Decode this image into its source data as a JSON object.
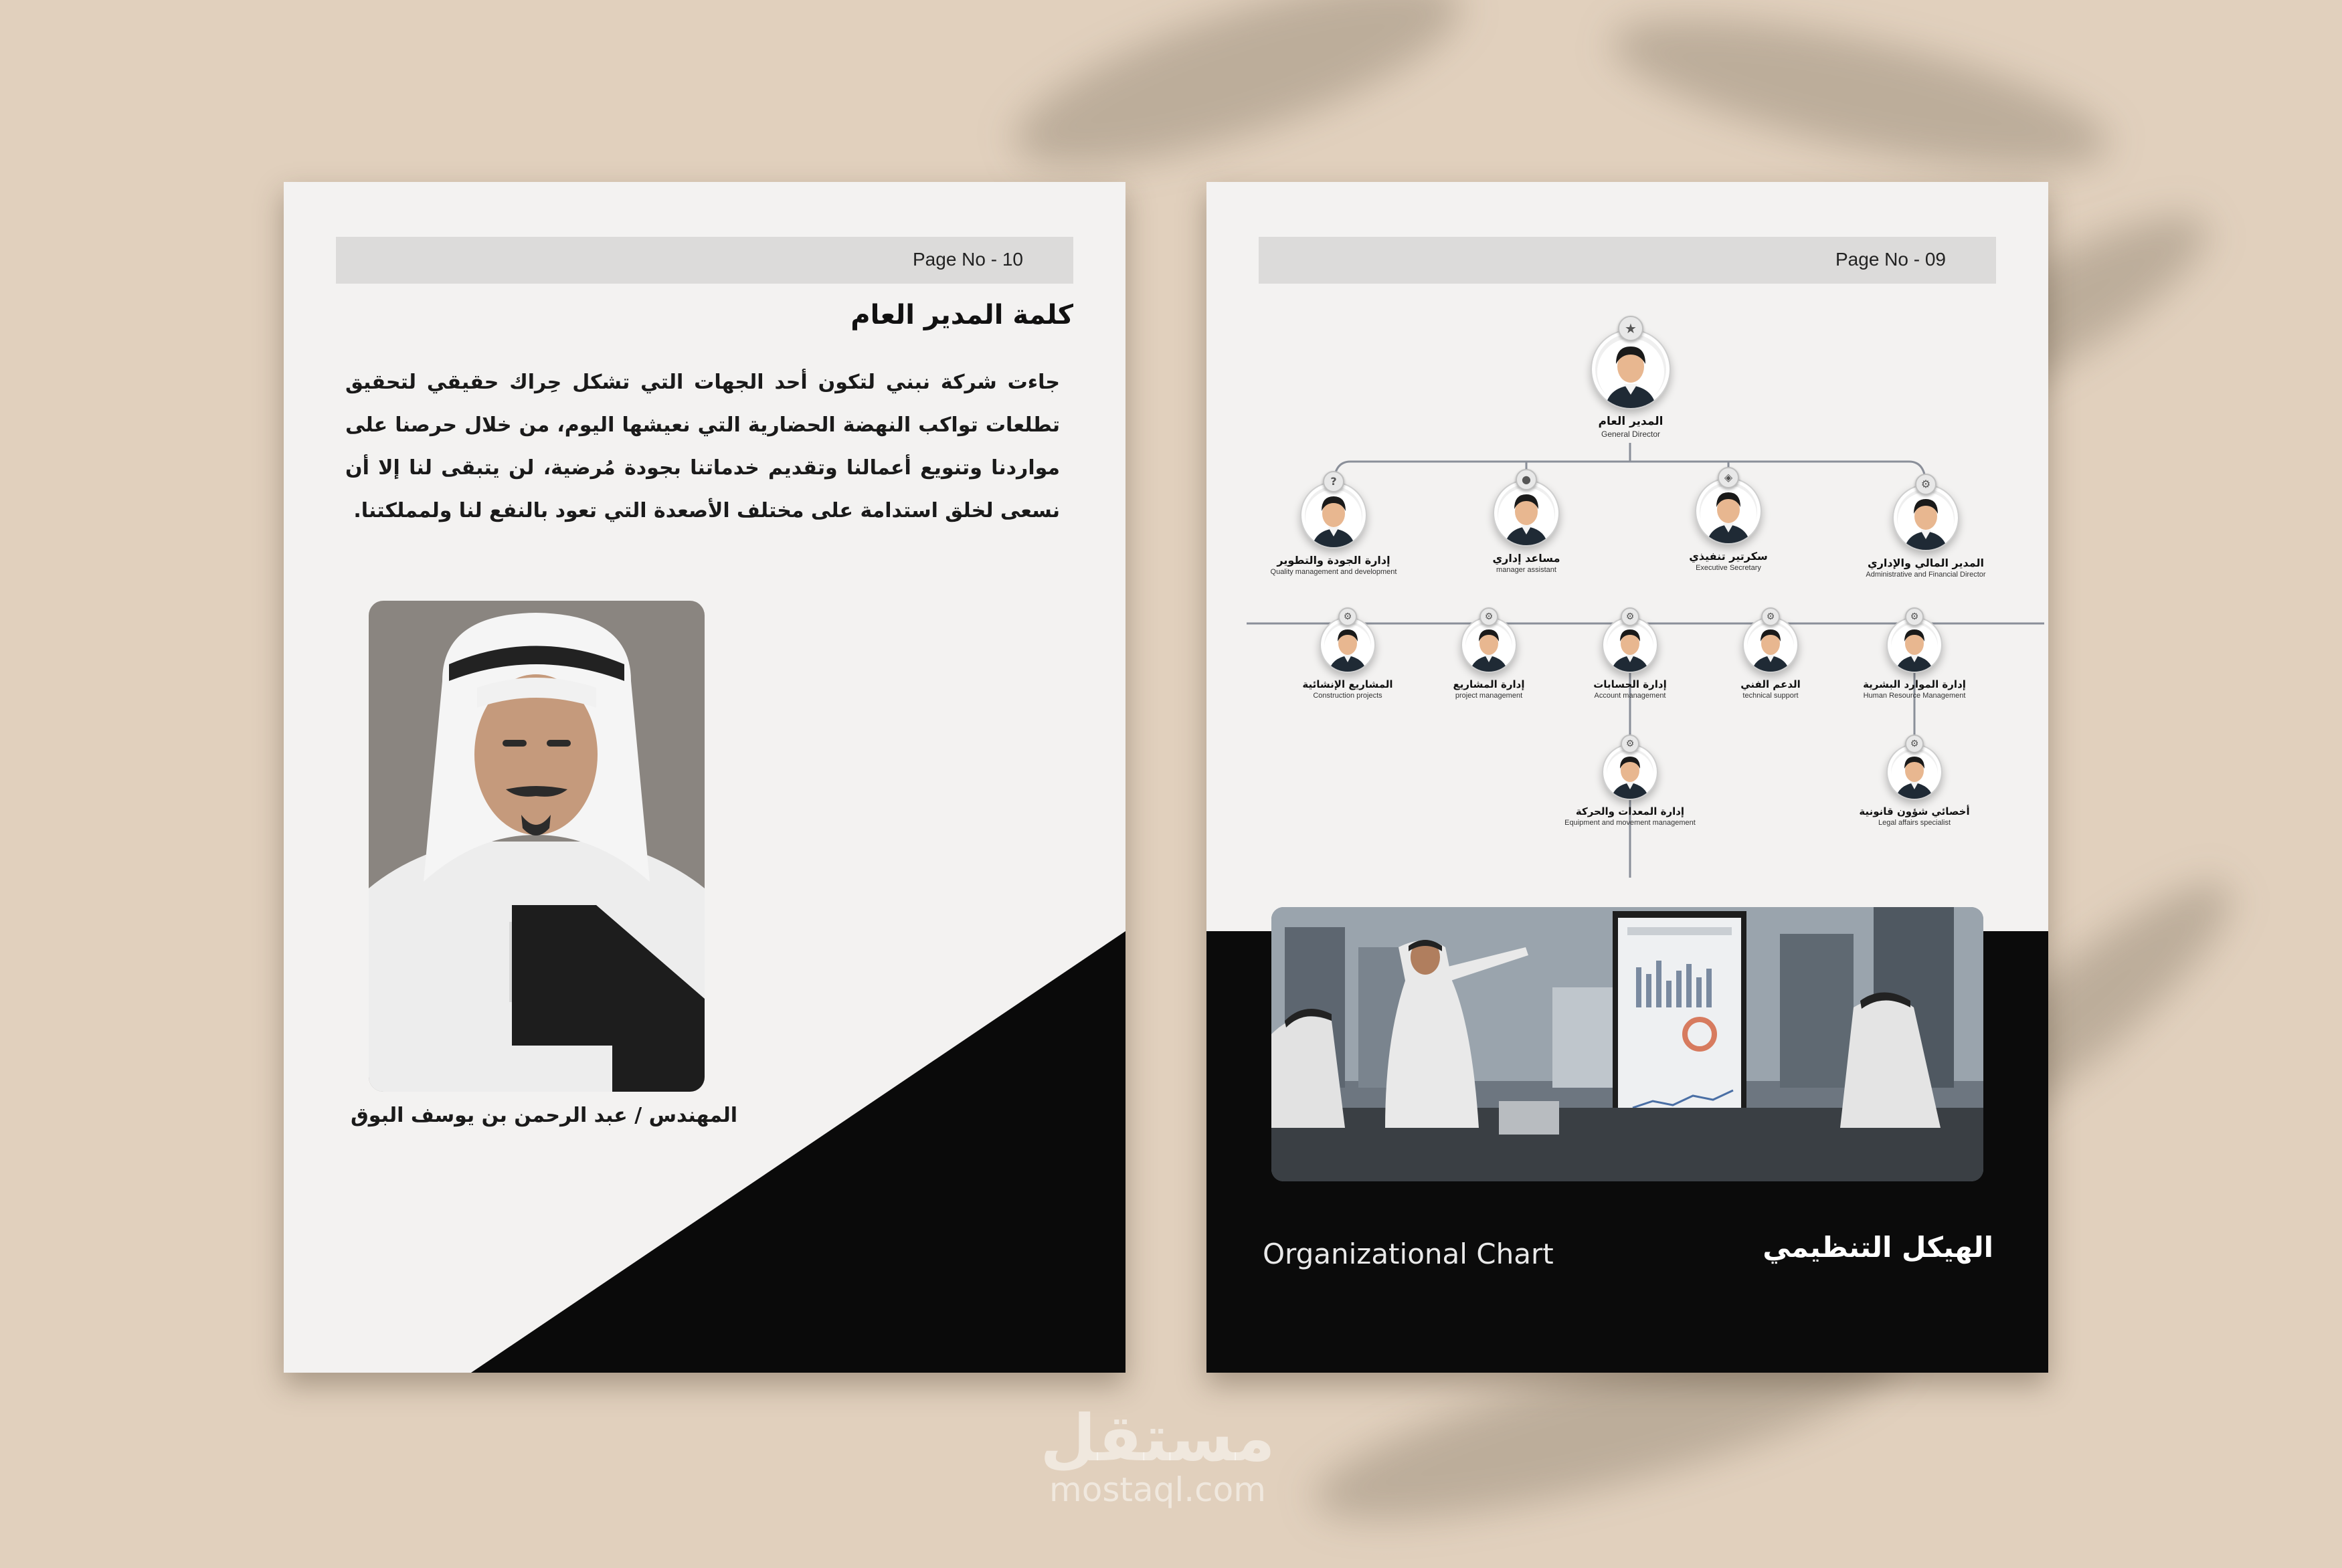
{
  "left_page": {
    "page_no": "Page No - 10",
    "title": "كلمة المدير العام",
    "body": "جاءت شركة نبني لتكون أحد الجهات التي تشكل حِراك حقيقي لتحقيق تطلعات تواكب النهضة الحضارية التي نعيشها اليوم، من خلال حرصنا على مواردنا وتنويع أعمالنا وتقديم خدماتنا بجودة مُرضية، لن يتبقى لنا إلا أن نسعى لخلق استدامة على مختلف الأصعدة التي تعود بالنفع لنا ولمملكتنا.",
    "caption": "المهندس / عبد الرحمن بن يوسف البوق"
  },
  "right_page": {
    "page_no": "Page No - 09",
    "org_chart": {
      "director": {
        "ar": "المدير العام",
        "en": "General Director"
      },
      "level2": [
        {
          "ar": "المدير المالي والإداري",
          "en": "Administrative and Financial Director"
        },
        {
          "ar": "سكرتير تنفيذي",
          "en": "Executive Secretary"
        },
        {
          "ar": "مساعد إداري",
          "en": "manager assistant"
        },
        {
          "ar": "إدارة الجودة والتطوير",
          "en": "Quality management and development"
        }
      ],
      "level3": [
        {
          "ar": "إدارة الموارد البشرية",
          "en": "Human Resource Management"
        },
        {
          "ar": "الدعم الفني",
          "en": "technical support"
        },
        {
          "ar": "إدارة الحسابات",
          "en": "Account management"
        },
        {
          "ar": "إدارة المشاريع",
          "en": "project management"
        },
        {
          "ar": "المشاريع الإنشائية",
          "en": "Construction projects"
        }
      ],
      "level4": [
        {
          "ar": "أخصائي شؤون قانونية",
          "en": "Legal affairs specialist"
        },
        {
          "ar": "إدارة المعدات والحركة",
          "en": "Equipment and movement management"
        }
      ]
    },
    "footer_en": "Organizational Chart",
    "footer_ar": "الهيكل التنظيمي"
  },
  "watermark": {
    "ar": "مستقل",
    "en": "mostaql.com"
  }
}
